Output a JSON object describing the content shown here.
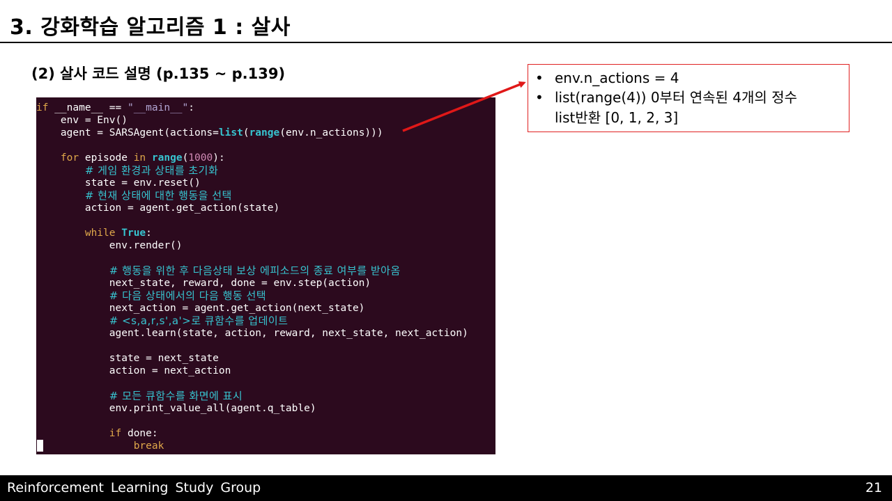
{
  "slide": {
    "title": "3. 강화학습 알고리즘 1 : 살사",
    "subtitle": "(2) 살사 코드 설명 (p.135 ~ p.139)"
  },
  "code": {
    "lines": [
      [
        {
          "t": "if",
          "c": "kw"
        },
        {
          "t": " __name__ == "
        },
        {
          "t": "\"__main__\"",
          "c": "str"
        },
        {
          "t": ":"
        }
      ],
      [
        {
          "t": "    env = Env()"
        }
      ],
      [
        {
          "t": "    agent = SARSAgent(actions="
        },
        {
          "t": "list",
          "c": "fn"
        },
        {
          "t": "("
        },
        {
          "t": "range",
          "c": "fn"
        },
        {
          "t": "(env.n_actions)))"
        }
      ],
      [],
      [
        {
          "t": "    "
        },
        {
          "t": "for",
          "c": "kw"
        },
        {
          "t": " episode "
        },
        {
          "t": "in",
          "c": "kw"
        },
        {
          "t": " "
        },
        {
          "t": "range",
          "c": "fn"
        },
        {
          "t": "("
        },
        {
          "t": "1000",
          "c": "num"
        },
        {
          "t": "):"
        }
      ],
      [
        {
          "t": "        "
        },
        {
          "t": "# 게임 환경과 상태를 초기화",
          "c": "cmt"
        }
      ],
      [
        {
          "t": "        state = env.reset()"
        }
      ],
      [
        {
          "t": "        "
        },
        {
          "t": "# 현재 상태에 대한 행동을 선택",
          "c": "cmt"
        }
      ],
      [
        {
          "t": "        action = agent.get_action(state)"
        }
      ],
      [],
      [
        {
          "t": "        "
        },
        {
          "t": "while",
          "c": "kw"
        },
        {
          "t": " "
        },
        {
          "t": "True",
          "c": "fn"
        },
        {
          "t": ":"
        }
      ],
      [
        {
          "t": "            env.render()"
        }
      ],
      [],
      [
        {
          "t": "            "
        },
        {
          "t": "# 행동을 위한 후 다음상태 보상 에피소드의 종료 여부를 받아옴",
          "c": "cmt"
        }
      ],
      [
        {
          "t": "            next_state, reward, done = env.step(action)"
        }
      ],
      [
        {
          "t": "            "
        },
        {
          "t": "# 다음 상태에서의 다음 행동 선택",
          "c": "cmt"
        }
      ],
      [
        {
          "t": "            next_action = agent.get_action(next_state)"
        }
      ],
      [
        {
          "t": "            "
        },
        {
          "t": "# <s,a,r,s',a'>로 큐함수를 업데이트",
          "c": "cmt"
        }
      ],
      [
        {
          "t": "            agent.learn(state, action, reward, next_state, next_action)"
        }
      ],
      [],
      [
        {
          "t": "            state = next_state"
        }
      ],
      [
        {
          "t": "            action = next_action"
        }
      ],
      [],
      [
        {
          "t": "            "
        },
        {
          "t": "# 모든 큐함수를 화면에 표시",
          "c": "cmt"
        }
      ],
      [
        {
          "t": "            env.print_value_all(agent.q_table)"
        }
      ],
      [],
      [
        {
          "t": "            "
        },
        {
          "t": "if",
          "c": "kw"
        },
        {
          "t": " done:"
        }
      ],
      [
        {
          "t": "                "
        },
        {
          "t": "break",
          "c": "kw"
        }
      ]
    ]
  },
  "callout": {
    "bullet": "•",
    "items": [
      {
        "text": "env.n_actions  = 4"
      },
      {
        "text": "list(range(4)) 0부터 연속된 4개의 정수"
      },
      {
        "text": "list반환 [0, 1, 2, 3]"
      }
    ],
    "border_color": "#e02020"
  },
  "footer": {
    "left": "Reinforcement Learning Study Group",
    "page_number": "21"
  },
  "colors": {
    "terminal_bg": "#2c0a1e",
    "keyword": "#e0a84a",
    "builtin": "#37c4d0",
    "string": "#b3a6d4",
    "number": "#d08ab5",
    "comment": "#37c4d0",
    "arrow": "#e01818"
  }
}
